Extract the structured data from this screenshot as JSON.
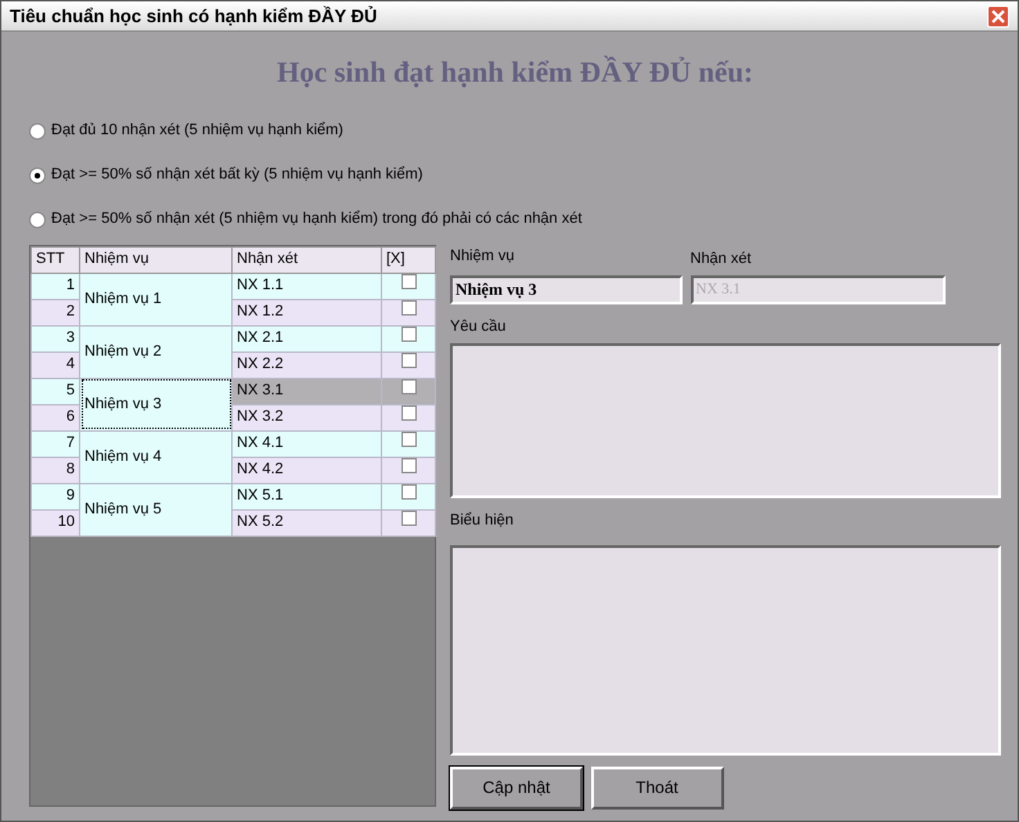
{
  "window": {
    "title": "Tiêu chuẩn học sinh có hạnh kiểm ĐẦY ĐỦ"
  },
  "heading": "Học sinh đạt hạnh kiểm ĐẦY ĐỦ nếu:",
  "options": [
    {
      "label": "Đạt đủ 10 nhận xét (5 nhiệm vụ hạnh kiểm)",
      "selected": false
    },
    {
      "label": "Đạt >= 50% số nhận xét bất kỳ (5 nhiệm vụ hạnh kiểm)",
      "selected": true
    },
    {
      "label": "Đạt >= 50% số nhận xét (5 nhiệm vụ hạnh kiểm) trong đó phải có các nhận xét",
      "selected": false
    }
  ],
  "grid": {
    "columns": [
      "STT",
      "Nhiệm vụ",
      "Nhận xét",
      "[X]"
    ],
    "groups": [
      {
        "task": "Nhiệm vụ 1",
        "focused": false,
        "rows": [
          {
            "stt": "1",
            "comment": "NX 1.1",
            "checked": false,
            "selected": false
          },
          {
            "stt": "2",
            "comment": "NX 1.2",
            "checked": false,
            "selected": false
          }
        ]
      },
      {
        "task": "Nhiệm vụ 2",
        "focused": false,
        "rows": [
          {
            "stt": "3",
            "comment": "NX 2.1",
            "checked": false,
            "selected": false
          },
          {
            "stt": "4",
            "comment": "NX 2.2",
            "checked": false,
            "selected": false
          }
        ]
      },
      {
        "task": "Nhiệm vụ 3",
        "focused": true,
        "rows": [
          {
            "stt": "5",
            "comment": "NX 3.1",
            "checked": false,
            "selected": true
          },
          {
            "stt": "6",
            "comment": "NX 3.2",
            "checked": false,
            "selected": false
          }
        ]
      },
      {
        "task": "Nhiệm vụ 4",
        "focused": false,
        "rows": [
          {
            "stt": "7",
            "comment": "NX 4.1",
            "checked": false,
            "selected": false
          },
          {
            "stt": "8",
            "comment": "NX 4.2",
            "checked": false,
            "selected": false
          }
        ]
      },
      {
        "task": "Nhiệm vụ 5",
        "focused": false,
        "rows": [
          {
            "stt": "9",
            "comment": "NX 5.1",
            "checked": false,
            "selected": false
          },
          {
            "stt": "10",
            "comment": "NX 5.2",
            "checked": false,
            "selected": false
          }
        ]
      }
    ]
  },
  "detail": {
    "task_label": "Nhiệm vụ",
    "task_value": "Nhiệm vụ 3",
    "comment_label": "Nhận xét",
    "comment_value": "NX 3.1",
    "comment_disabled": true,
    "requirement_label": "Yêu cầu",
    "expression_label": "Biểu hiện"
  },
  "buttons": [
    {
      "label": "Cập nhật",
      "default": true
    },
    {
      "label": "Thoát",
      "default": false
    }
  ]
}
